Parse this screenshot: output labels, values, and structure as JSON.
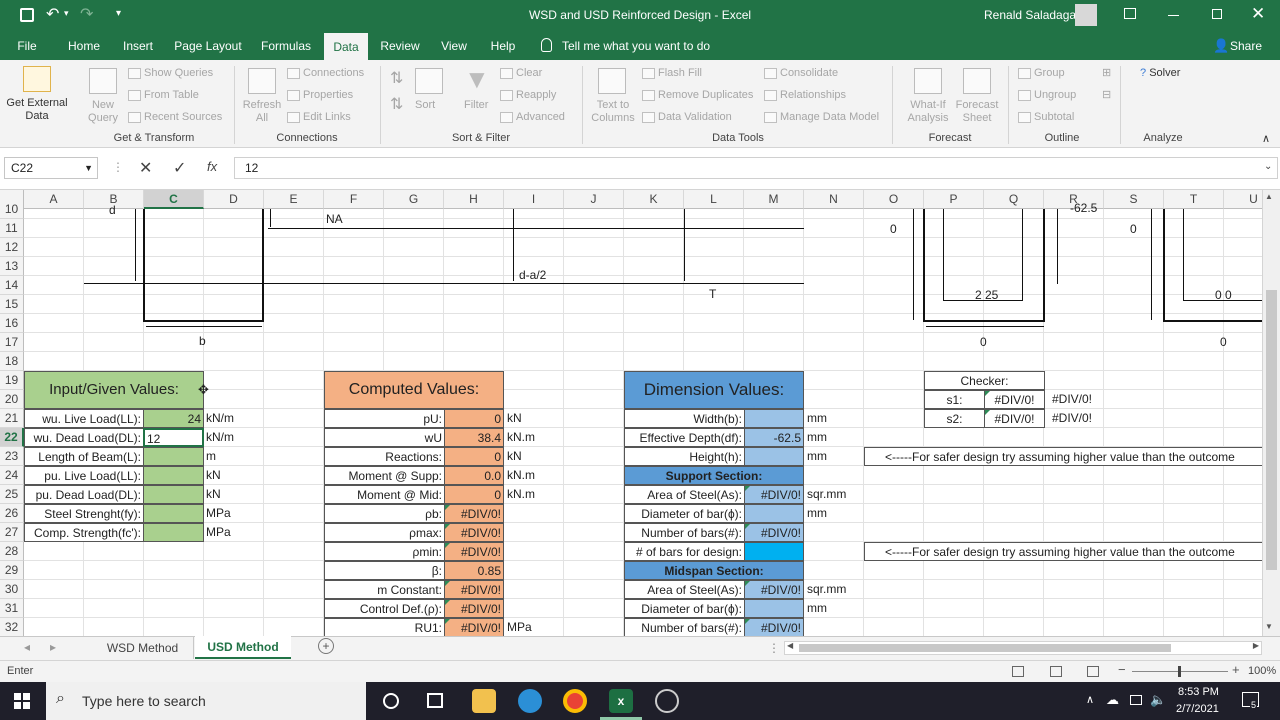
{
  "titlebar": {
    "title": "WSD and USD Reinforced Design  -  Excel",
    "user": "Renald Saladaga"
  },
  "ribbon_tabs": [
    {
      "label": "File"
    },
    {
      "label": "Home"
    },
    {
      "label": "Insert"
    },
    {
      "label": "Page Layout"
    },
    {
      "label": "Formulas"
    },
    {
      "label": "Data"
    },
    {
      "label": "Review"
    },
    {
      "label": "View"
    },
    {
      "label": "Help"
    }
  ],
  "tell_me": "Tell me what you want to do",
  "share": "Share",
  "ribbon": {
    "get_external": "Get External Data",
    "new_query": "New Query",
    "show_queries": "Show Queries",
    "from_table": "From Table",
    "recent_sources": "Recent Sources",
    "refresh_all": "Refresh All",
    "connections": "Connections",
    "properties": "Properties",
    "edit_links": "Edit Links",
    "sort": "Sort",
    "filter": "Filter",
    "clear": "Clear",
    "reapply": "Reapply",
    "advanced": "Advanced",
    "text_to_columns": "Text to Columns",
    "flash_fill": "Flash Fill",
    "remove_duplicates": "Remove Duplicates",
    "data_validation": "Data Validation",
    "consolidate": "Consolidate",
    "relationships": "Relationships",
    "manage_data_model": "Manage Data Model",
    "what_if": "What-If Analysis",
    "forecast_sheet": "Forecast Sheet",
    "group": "Group",
    "ungroup": "Ungroup",
    "subtotal": "Subtotal",
    "solver": "Solver",
    "groups": {
      "get_transform": "Get & Transform",
      "connections": "Connections",
      "sort_filter": "Sort & Filter",
      "data_tools": "Data Tools",
      "forecast": "Forecast",
      "outline": "Outline",
      "analyze": "Analyze"
    }
  },
  "formula_bar": {
    "name_box": "C22",
    "formula": "12",
    "fx": "fx"
  },
  "columns": [
    "A",
    "B",
    "C",
    "D",
    "E",
    "F",
    "G",
    "H",
    "I",
    "J",
    "K",
    "L",
    "M",
    "N",
    "O",
    "P",
    "Q",
    "R",
    "S",
    "T",
    "U"
  ],
  "rows": [
    "10",
    "11",
    "12",
    "13",
    "14",
    "15",
    "16",
    "17",
    "18",
    "19",
    "20",
    "21",
    "22",
    "23",
    "24",
    "25",
    "26",
    "27",
    "28",
    "29",
    "30",
    "31",
    "32"
  ],
  "diagram": {
    "na": "NA",
    "d": "d",
    "d_a2": "d-a/2",
    "t": "T",
    "b": "b",
    "neg": "-62.5",
    "zero1": "0",
    "zero2": "0",
    "zero3": "0",
    "zero4": "0",
    "s225": "2 25",
    "s00": "0 0"
  },
  "input": {
    "header": "Input/Given Values:",
    "rows": [
      {
        "label": "wu. Live Load(LL):",
        "value": "24",
        "unit": "kN/m"
      },
      {
        "label": "wu. Dead Load(DL):",
        "value": "12",
        "unit": "kN/m"
      },
      {
        "label": "Length of Beam(L):",
        "value": "",
        "unit": "m"
      },
      {
        "label": "pu. Live Load(LL):",
        "value": "",
        "unit": "kN"
      },
      {
        "label": "pu. Dead Load(DL):",
        "value": "",
        "unit": "kN"
      },
      {
        "label": "Steel Strenght(fy):",
        "value": "",
        "unit": "MPa"
      },
      {
        "label": "Comp. Strength(fc'):",
        "value": "",
        "unit": "MPa"
      }
    ]
  },
  "computed": {
    "header": "Computed Values:",
    "rows": [
      {
        "label": "pU:",
        "value": "0",
        "unit": "kN"
      },
      {
        "label": "wU",
        "value": "38.4",
        "unit": "kN.m"
      },
      {
        "label": "Reactions:",
        "value": "0",
        "unit": "kN"
      },
      {
        "label": "Moment @ Supp:",
        "value": "0.0",
        "unit": "kN.m"
      },
      {
        "label": "Moment @ Mid:",
        "value": "0",
        "unit": "kN.m"
      },
      {
        "label": "ρb:",
        "value": "#DIV/0!",
        "unit": ""
      },
      {
        "label": "ρmax:",
        "value": "#DIV/0!",
        "unit": ""
      },
      {
        "label": "ρmin:",
        "value": "#DIV/0!",
        "unit": ""
      },
      {
        "label": "β:",
        "value": "0.85",
        "unit": ""
      },
      {
        "label": "m Constant:",
        "value": "#DIV/0!",
        "unit": ""
      },
      {
        "label": "Control Def.(ρ):",
        "value": "#DIV/0!",
        "unit": ""
      },
      {
        "label": "RU1:",
        "value": "#DIV/0!",
        "unit": "MPa"
      }
    ]
  },
  "dimension": {
    "header": "Dimension Values:",
    "rows": [
      {
        "label": "Width(b):",
        "value": "",
        "unit": "mm",
        "kind": "row"
      },
      {
        "label": "Effective Depth(df):",
        "value": "-62.5",
        "unit": "mm",
        "kind": "row"
      },
      {
        "label": "Height(h):",
        "value": "",
        "unit": "mm",
        "kind": "row"
      },
      {
        "label": "Support Section:",
        "value": "",
        "unit": "",
        "kind": "section"
      },
      {
        "label": "Area of Steel(As):",
        "value": "#DIV/0!",
        "unit": "sqr.mm",
        "kind": "row"
      },
      {
        "label": "Diameter of bar(ϕ):",
        "value": "",
        "unit": "mm",
        "kind": "row"
      },
      {
        "label": "Number of bars(#):",
        "value": "#DIV/0!",
        "unit": "",
        "kind": "row"
      },
      {
        "label": "# of bars for design:",
        "value": "",
        "unit": "",
        "kind": "row"
      },
      {
        "label": "Midspan Section:",
        "value": "",
        "unit": "",
        "kind": "section"
      },
      {
        "label": "Area of Steel(As):",
        "value": "#DIV/0!",
        "unit": "sqr.mm",
        "kind": "row"
      },
      {
        "label": "Diameter of bar(ϕ):",
        "value": "",
        "unit": "mm",
        "kind": "row"
      },
      {
        "label": "Number of bars(#):",
        "value": "#DIV/0!",
        "unit": "",
        "kind": "row"
      }
    ]
  },
  "checker": {
    "header": "Checker:",
    "rows": [
      {
        "label": "s1:",
        "value": "#DIV/0!",
        "extra": "#DIV/0!"
      },
      {
        "label": "s2:",
        "value": "#DIV/0!",
        "extra": "#DIV/0!"
      }
    ]
  },
  "notes": {
    "n1": "<-----For safer design try assuming higher value than the outcome",
    "n2": "<-----For safer design try assuming higher value than the outcome"
  },
  "sheets": [
    {
      "label": "WSD Method"
    },
    {
      "label": "USD Method"
    }
  ],
  "status": {
    "mode": "Enter",
    "zoom": "100%"
  },
  "taskbar": {
    "search": "Type here to search",
    "time": "8:53 PM",
    "date": "2/7/2021",
    "notif": "5"
  },
  "colors": {
    "excel_green": "#217346",
    "input_green": "#a9d08e",
    "computed_orange": "#f4b084",
    "dimension_blue": "#9bc2e6",
    "header_blue": "#5b9bd5"
  }
}
